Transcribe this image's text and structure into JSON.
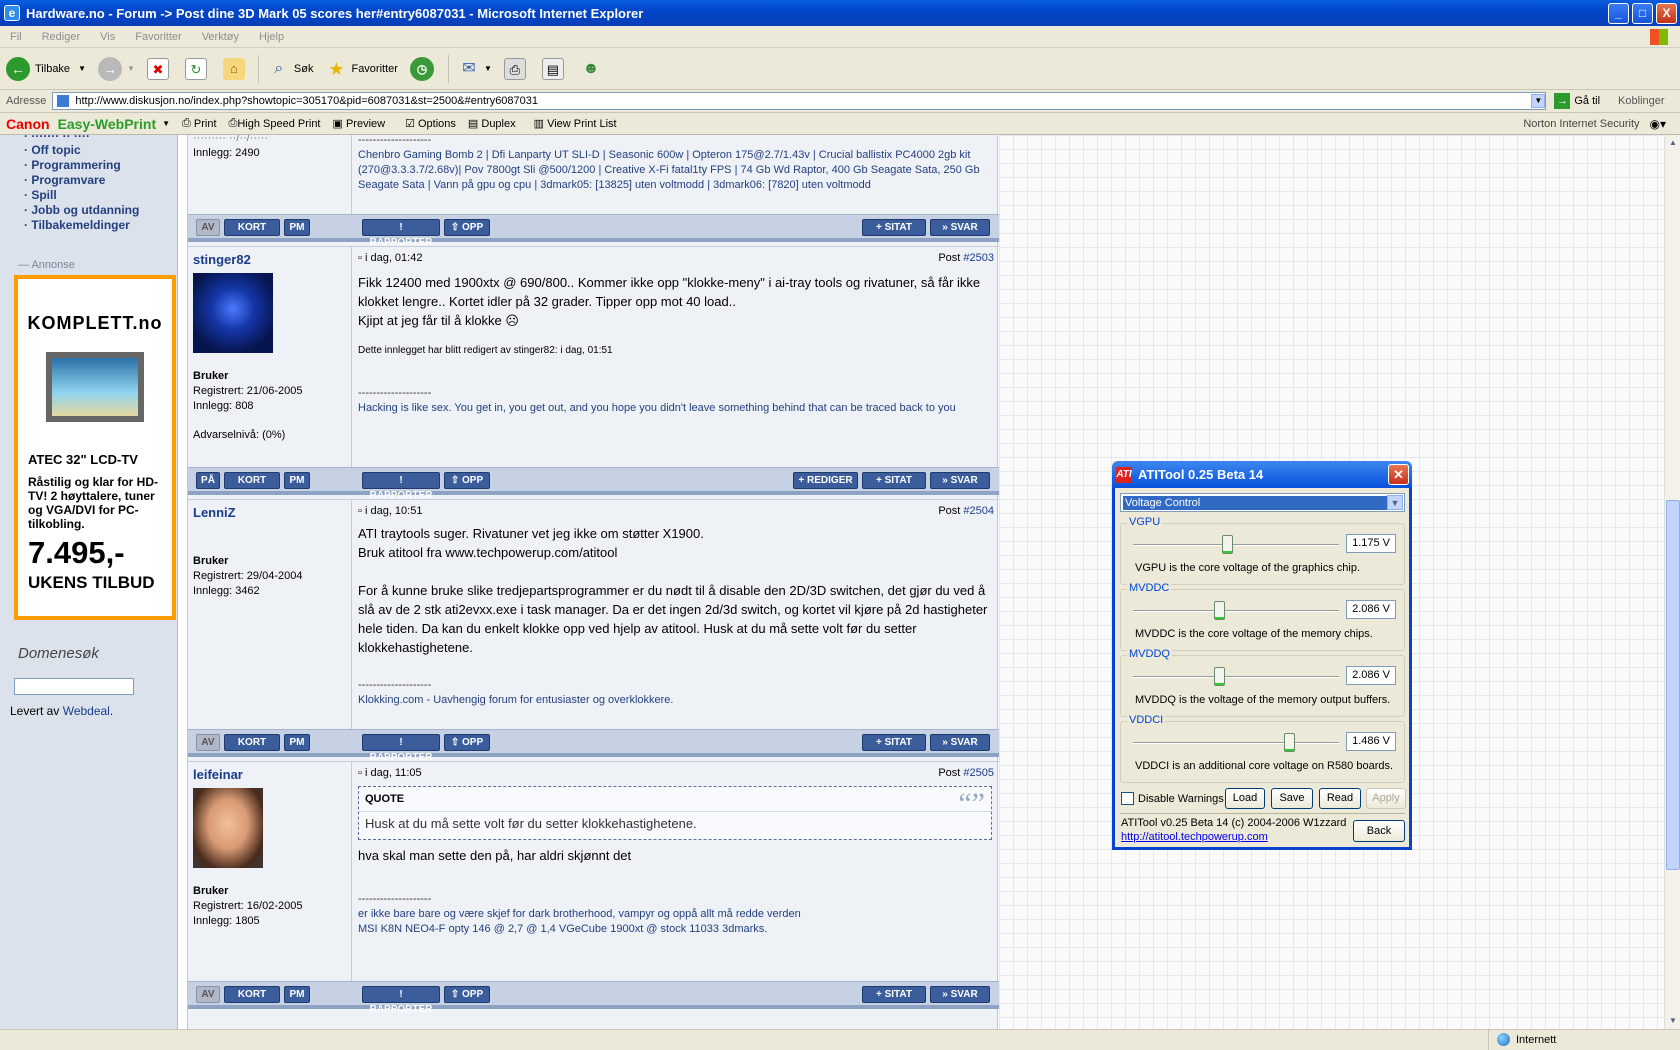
{
  "window": {
    "title": "Hardware.no - Forum -> Post dine 3D Mark 05 scores her#entry6087031 - Microsoft Internet Explorer",
    "minimize": "_",
    "maximize": "□",
    "close": "X"
  },
  "menu": [
    "Fil",
    "Rediger",
    "Vis",
    "Favoritter",
    "Verktøy",
    "Hjelp"
  ],
  "toolbar": {
    "back": "Tilbake",
    "search": "Søk",
    "favorites": "Favoritter"
  },
  "address": {
    "label": "Adresse",
    "url": "http://www.diskusjon.no/index.php?showtopic=305170&pid=6087031&st=2500&#entry6087031",
    "go": "Gå til",
    "links": "Koblinger"
  },
  "linksbar": {
    "canon": "Canon",
    "easy": "Easy-WebPrint",
    "print": "Print",
    "highspeed": "High Speed Print",
    "preview": "Preview",
    "options": "Options",
    "duplex": "Duplex",
    "viewlist": "View Print List",
    "norton": "Norton Internet Security"
  },
  "sidebar": {
    "nav": [
      "Off topic",
      "Programmering",
      "Programvare",
      "Spill",
      "Jobb og utdanning",
      "Tilbakemeldinger"
    ],
    "annonse": "Annonse",
    "ad": {
      "brand": "KOMPLETT.no",
      "model": "ATEC 32\" LCD-TV",
      "text": "Råstilig og klar for HD-TV! 2 høyttalere, tuner og VGA/DVI for PC-tilkobling.",
      "price": "7.495,-",
      "offer": "UKENS TILBUD"
    },
    "domenesok": "Domenesøk",
    "levert_prefix": "Levert av",
    "levert_link": "Webdeal",
    "levert_suffix": "."
  },
  "buttons": {
    "av": "AV",
    "pa": "PÅ",
    "kort": "KORT",
    "pm": "PM",
    "rapporter": "! RAPPORTER",
    "opp": "⇧ OPP",
    "rediger": "+ REDIGER",
    "sitat": "+ SITAT",
    "svar": "» SVAR"
  },
  "post0": {
    "innlegg": "Innlegg: 2490",
    "sig": "Chenbro Gaming Bomb 2 | Dfi Lanparty UT SLI-D | Seasonic 600w | Opteron 175@2.7/1.43v | Crucial ballistix PC4000 2gb kit (270@3.3.3.7/2.68v)| Pov 7800gt Sli @500/1200 | Creative X-Fi fatal1ty FPS | 74 Gb Wd Raptor, 400 Gb Seagate Sata, 250 Gb Seagate Sata | Vann på gpu og cpu | 3dmark05: [13825] uten voltmodd | 3dmark06: [7820] uten voltmodd"
  },
  "posts": [
    {
      "user": "stinger82",
      "date": "i dag, 01:42",
      "post_label": "Post",
      "post_no": "#2503",
      "role": "Bruker",
      "reg": "Registrert: 21/06-2005",
      "innlegg": "Innlegg: 808",
      "warn": "Advarselnivå: (0%)",
      "body": "Fikk 12400 med 1900xtx @ 690/800.. Kommer ikke opp \"klokke-meny\" i ai-tray tools og rivatuner, så får ikke klokket lengre.. Kortet idler på 32 grader. Tipper opp mot 40 load..\nKjipt at jeg får til å klokke ☹",
      "edited": "Dette innlegget har blitt redigert av stinger82: i dag, 01:51",
      "dashes": "--------------------",
      "sig": "Hacking is like sex. You get in, you get out, and you hope you didn't leave something behind that can be traced back to you"
    },
    {
      "user": "LenniZ",
      "date": "i dag, 10:51",
      "post_label": "Post",
      "post_no": "#2504",
      "role": "Bruker",
      "reg": "Registrert: 29/04-2004",
      "innlegg": "Innlegg: 3462",
      "body": "ATI traytools suger. Rivatuner vet jeg ikke om støtter X1900.\nBruk atitool fra www.techpowerup.com/atitool\n\nFor å kunne bruke slike tredjepartsprogrammer er du nødt til å disable den 2D/3D switchen, det gjør du ved å slå av de 2 stk ati2evxx.exe i task manager. Da er det ingen 2d/3d switch, og kortet vil kjøre på 2d hastigheter hele tiden. Da kan du enkelt klokke opp ved hjelp av atitool. Husk at du må sette volt før du setter klokkehastighetene.",
      "dashes": "--------------------",
      "sig": "Klokking.com - Uavhengig forum for entusiaster og overklokkere."
    },
    {
      "user": "leifeinar",
      "date": "i dag, 11:05",
      "post_label": "Post",
      "post_no": "#2505",
      "role": "Bruker",
      "reg": "Registrert: 16/02-2005",
      "innlegg": "Innlegg: 1805",
      "quote_label": "QUOTE",
      "quote": "Husk at du må sette volt før du setter klokkehastighetene.",
      "body": "hva skal man sette den på, har aldri skjønnt det",
      "dashes": "--------------------",
      "sig": "er ikke bare bare og være skjef for dark brotherhood, vampyr og oppå allt må redde verden\nMSI K8N NEO4-F opty 146 @ 2,7 @ 1,4 VGeCube 1900xt @ stock 11033 3dmarks."
    }
  ],
  "atitool": {
    "title": "ATITool 0.25 Beta 14",
    "mode": "Voltage Control",
    "controls": [
      {
        "name": "VGPU",
        "value": "1.175 V",
        "level": 0.47,
        "desc": "VGPU is the core voltage of the graphics chip."
      },
      {
        "name": "MVDDC",
        "value": "2.086 V",
        "level": 0.43,
        "desc": "MVDDC is the core voltage of the memory chips."
      },
      {
        "name": "MVDDQ",
        "value": "2.086 V",
        "level": 0.43,
        "desc": "MVDDQ is the voltage of the memory output buffers."
      },
      {
        "name": "VDDCI",
        "value": "1.486 V",
        "level": 0.78,
        "desc": "VDDCI is an additional core voltage on R580 boards."
      }
    ],
    "disable_warnings": "Disable Warnings",
    "load": "Load",
    "save": "Save",
    "read": "Read",
    "apply": "Apply",
    "copyright": "ATITool v0.25 Beta 14 (c) 2004-2006 W1zzard",
    "link": "http://atitool.techpowerup.com",
    "back": "Back"
  },
  "status": {
    "zone": "Internett"
  }
}
